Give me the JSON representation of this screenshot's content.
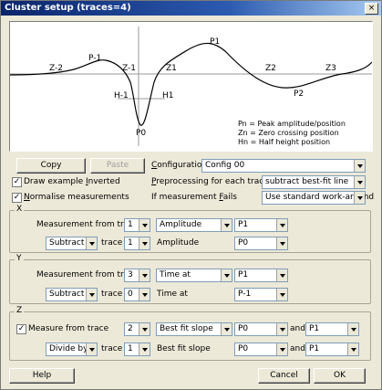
{
  "window": {
    "title": "Cluster setup (traces=4)",
    "close": "×"
  },
  "plot": {
    "labels": [
      "Z-2",
      "P-1",
      "Z-1",
      "Z1",
      "P1",
      "Z2",
      "Z3",
      "P2",
      "H-1",
      "H1",
      "P0"
    ],
    "legend": [
      "Pn = Peak amplitude/position",
      "Zn = Zero crossing position",
      "Hn = Half height position"
    ]
  },
  "buttons": {
    "copy": "Copy",
    "paste": "Paste",
    "help": "Help",
    "cancel": "Cancel",
    "ok": "OK"
  },
  "config": {
    "label": "Configuration",
    "value": "Config 00"
  },
  "draw_inverted": {
    "label": "Draw example Inverted",
    "checked": true
  },
  "preprocessing": {
    "label": "Preprocessing for each trace",
    "value": "subtract best-fit line"
  },
  "normalise": {
    "label": "Normalise measurements",
    "checked": true
  },
  "fails": {
    "label": "If measurement Fails",
    "value": "Use standard work-around"
  },
  "x": {
    "title": "X",
    "meas_label": "Measurement from trace",
    "trace": "1",
    "type": "Amplitude",
    "point": "P1",
    "op": "Subtract",
    "trace_label": "trace",
    "trace2": "1",
    "type2": "Amplitude",
    "point2": "P0"
  },
  "y": {
    "title": "Y",
    "meas_label": "Measurement from trace",
    "trace": "3",
    "type": "Time at",
    "point": "P1",
    "op": "Subtract",
    "trace_label": "trace",
    "trace2": "0",
    "type2": "Time at",
    "point2": "P-1"
  },
  "z": {
    "title": "Z",
    "meas_label": "Measure from trace",
    "checked": true,
    "trace": "2",
    "type": "Best fit slope",
    "point": "P0",
    "and": "and",
    "point_b": "P1",
    "op": "Divide by",
    "trace_label": "trace",
    "trace2": "1",
    "type2": "Best fit slope",
    "point2": "P0",
    "and2": "and",
    "point2_b": "P1"
  }
}
